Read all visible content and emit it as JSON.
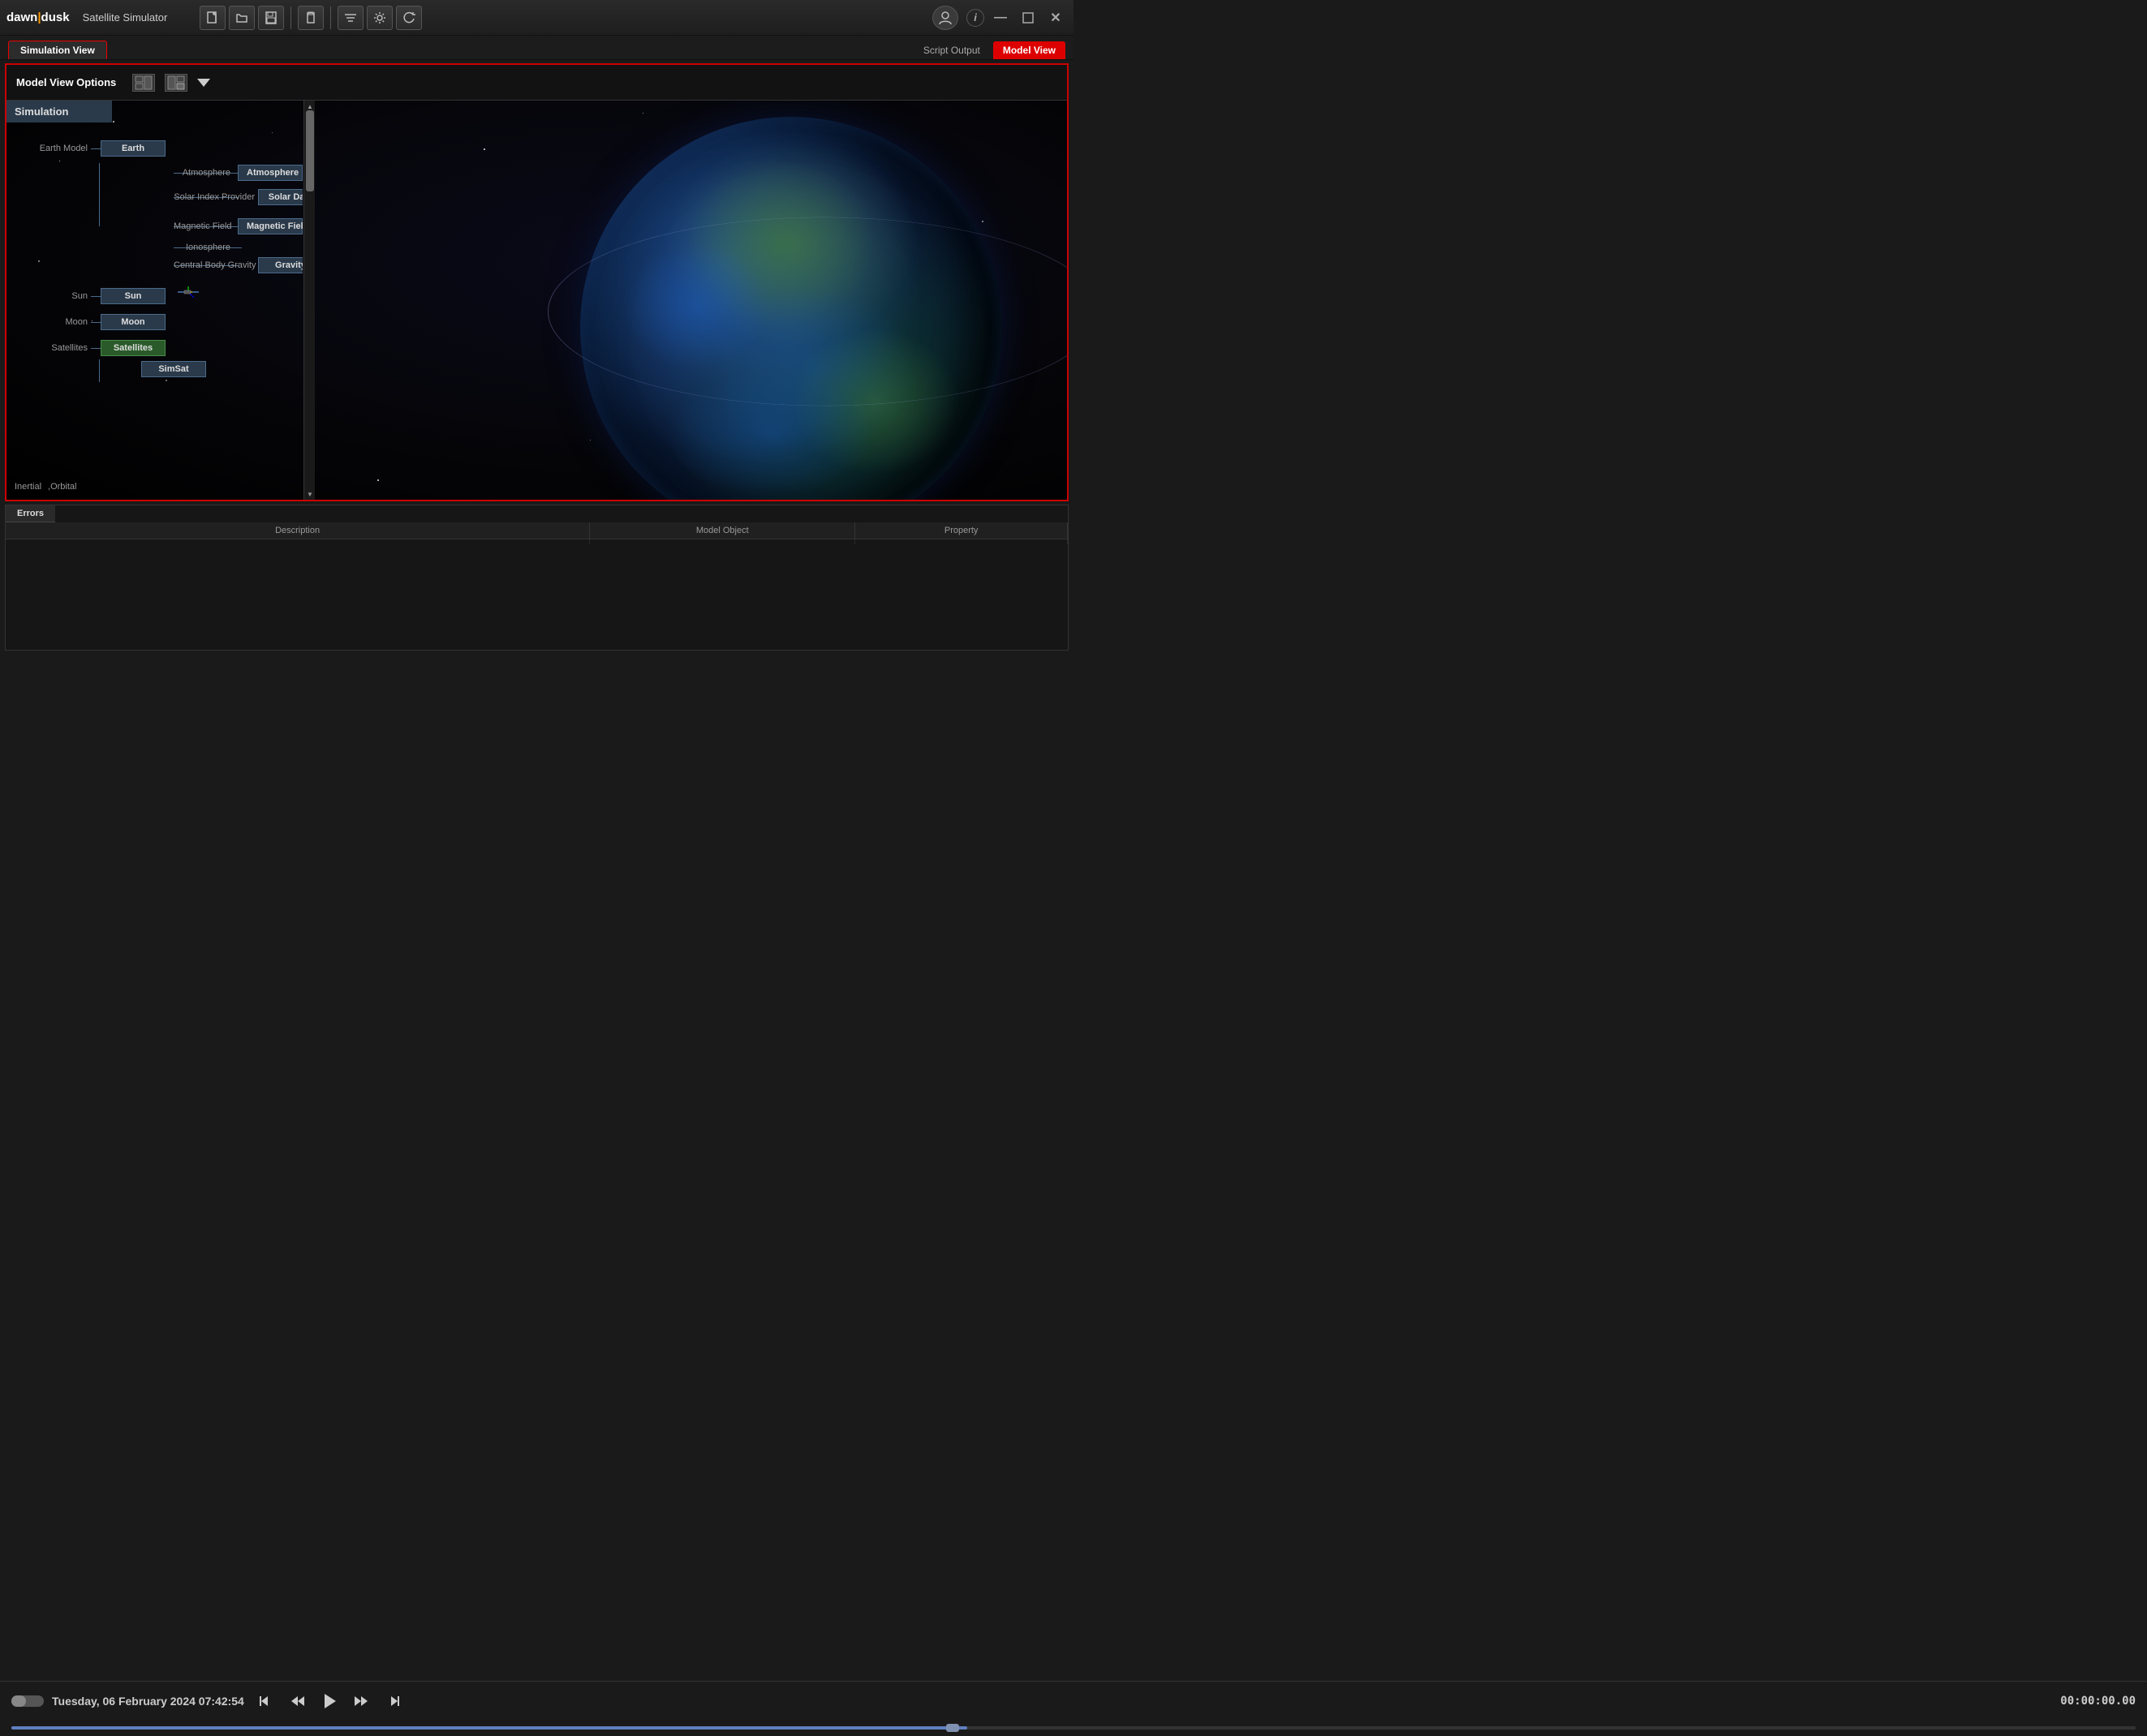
{
  "app": {
    "logo": "dawn|dusk",
    "title": "Satellite Simulator"
  },
  "titlebar": {
    "new_btn": "📄",
    "open_btn": "📂",
    "save_btn": "💾",
    "clipboard_btn": "📋",
    "settings_btn": "⚙",
    "refresh_btn": "↺",
    "user_icon": "👤",
    "info_btn": "i",
    "minimize": "—",
    "maximize": "□",
    "close": "✕"
  },
  "tabs": {
    "simulation_view": "Simulation View",
    "script_output": "Script Output",
    "model_view": "Model View"
  },
  "options": {
    "label": "Model View Options",
    "icon1": "🖥",
    "icon2": "📊"
  },
  "tree": {
    "header": "Simulation",
    "nodes": [
      {
        "id": "earth-model",
        "label": "Earth Model",
        "box": "Earth",
        "children": [
          {
            "id": "atmosphere",
            "label": "Atmosphere",
            "box": "Atmosphere"
          },
          {
            "id": "solar-index",
            "label": "Solar Index Provider",
            "box": "Solar Data"
          },
          {
            "id": "magnetic-field",
            "label": "Magnetic Field",
            "box": "Magnetic Field"
          },
          {
            "id": "ionosphere",
            "label": "Ionosphere",
            "box": ""
          },
          {
            "id": "gravity",
            "label": "Central Body Gravity",
            "box": "Gravity"
          }
        ]
      },
      {
        "id": "sun",
        "label": "Sun",
        "box": "Sun"
      },
      {
        "id": "moon",
        "label": "Moon",
        "box": "Moon"
      },
      {
        "id": "satellites",
        "label": "Satellites",
        "box": "Satellites",
        "selected": true,
        "children": [
          {
            "id": "simsat",
            "label": "",
            "box": "SimSat"
          }
        ]
      }
    ]
  },
  "bottom_labels": {
    "inertial": "Inertial",
    "orbital": ",Orbital"
  },
  "errors": {
    "tab_label": "Errors",
    "columns": [
      "Description",
      "Model Object",
      "Property"
    ]
  },
  "playback": {
    "datetime": "Tuesday, 06 February 2024 07:42:54",
    "timecode": "00:00:00.00"
  }
}
